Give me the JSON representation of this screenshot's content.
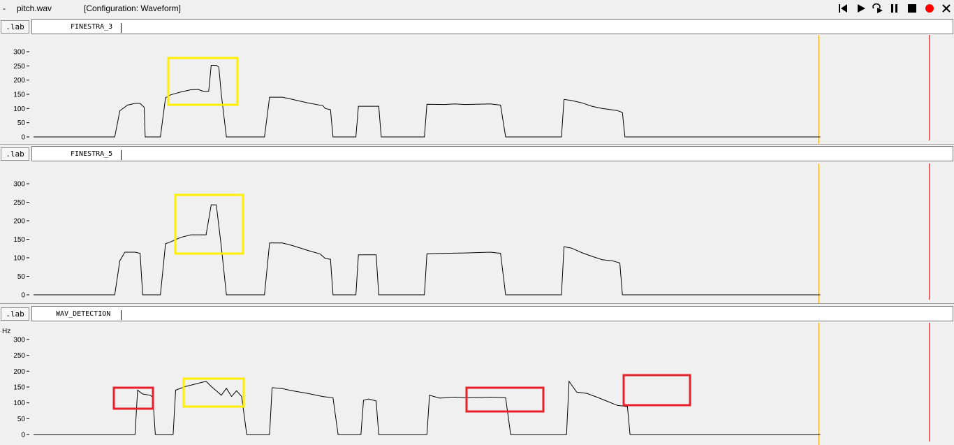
{
  "window": {
    "menu_glyph": "-",
    "filename": "pitch.wav",
    "configuration": "[Configuration: Waveform]"
  },
  "toolbar": {
    "icons": [
      "skip-to-start-icon",
      "play-icon",
      "loop-play-icon",
      "pause-icon",
      "stop-icon",
      "record-icon",
      "close-icon"
    ],
    "record_color": "#ff0000"
  },
  "colors": {
    "marker_orange": "#f0a020",
    "marker_red": "#e02020",
    "highlight_yellow": "#ffee00",
    "highlight_red": "#e8202a"
  },
  "tracks": [
    {
      "lab_button": ".lab",
      "label": "FINESTRA_3",
      "unit": "",
      "yticks": [
        300,
        250,
        200,
        150,
        100,
        50,
        0
      ],
      "points": [
        [
          0,
          0
        ],
        [
          0.16,
          0
        ],
        [
          0.17,
          92
        ],
        [
          0.185,
          112
        ],
        [
          0.2,
          118
        ],
        [
          0.21,
          118
        ],
        [
          0.218,
          104
        ],
        [
          0.22,
          0
        ],
        [
          0.25,
          0
        ],
        [
          0.26,
          138
        ],
        [
          0.27,
          148
        ],
        [
          0.29,
          158
        ],
        [
          0.31,
          166
        ],
        [
          0.325,
          167
        ],
        [
          0.335,
          160
        ],
        [
          0.345,
          160
        ],
        [
          0.35,
          252
        ],
        [
          0.36,
          252
        ],
        [
          0.365,
          246
        ],
        [
          0.37,
          150
        ],
        [
          0.38,
          0
        ],
        [
          0.455,
          0
        ],
        [
          0.465,
          140
        ],
        [
          0.49,
          140
        ],
        [
          0.51,
          132
        ],
        [
          0.54,
          120
        ],
        [
          0.57,
          110
        ],
        [
          0.575,
          100
        ],
        [
          0.585,
          96
        ],
        [
          0.59,
          0
        ],
        [
          0.635,
          0
        ],
        [
          0.64,
          108
        ],
        [
          0.68,
          108
        ],
        [
          0.685,
          0
        ],
        [
          0.77,
          0
        ],
        [
          0.775,
          115
        ],
        [
          0.81,
          114
        ],
        [
          0.83,
          116
        ],
        [
          0.85,
          114
        ],
        [
          0.9,
          116
        ],
        [
          0.92,
          112
        ],
        [
          0.93,
          0
        ],
        [
          1.04,
          0
        ],
        [
          1.045,
          132
        ],
        [
          1.06,
          128
        ],
        [
          1.08,
          120
        ],
        [
          1.1,
          108
        ],
        [
          1.12,
          100
        ],
        [
          1.15,
          93
        ],
        [
          1.16,
          86
        ],
        [
          1.165,
          0
        ],
        [
          1.55,
          0
        ]
      ]
    },
    {
      "lab_button": ".lab",
      "label": "FINESTRA_5",
      "unit": "",
      "yticks": [
        300,
        250,
        200,
        150,
        100,
        50,
        0
      ],
      "points": [
        [
          0,
          0
        ],
        [
          0.16,
          0
        ],
        [
          0.17,
          92
        ],
        [
          0.18,
          115
        ],
        [
          0.2,
          115
        ],
        [
          0.21,
          112
        ],
        [
          0.215,
          0
        ],
        [
          0.25,
          0
        ],
        [
          0.26,
          138
        ],
        [
          0.27,
          143
        ],
        [
          0.29,
          155
        ],
        [
          0.31,
          162
        ],
        [
          0.34,
          162
        ],
        [
          0.35,
          243
        ],
        [
          0.36,
          243
        ],
        [
          0.37,
          130
        ],
        [
          0.38,
          0
        ],
        [
          0.455,
          0
        ],
        [
          0.465,
          140
        ],
        [
          0.49,
          140
        ],
        [
          0.51,
          133
        ],
        [
          0.54,
          120
        ],
        [
          0.565,
          110
        ],
        [
          0.575,
          98
        ],
        [
          0.585,
          96
        ],
        [
          0.59,
          0
        ],
        [
          0.635,
          0
        ],
        [
          0.64,
          108
        ],
        [
          0.675,
          108
        ],
        [
          0.68,
          0
        ],
        [
          0.77,
          0
        ],
        [
          0.775,
          111
        ],
        [
          0.81,
          112
        ],
        [
          0.85,
          113
        ],
        [
          0.9,
          115
        ],
        [
          0.92,
          112
        ],
        [
          0.93,
          0
        ],
        [
          1.04,
          0
        ],
        [
          1.045,
          130
        ],
        [
          1.06,
          126
        ],
        [
          1.08,
          114
        ],
        [
          1.1,
          104
        ],
        [
          1.12,
          95
        ],
        [
          1.14,
          92
        ],
        [
          1.155,
          86
        ],
        [
          1.16,
          0
        ],
        [
          1.55,
          0
        ]
      ]
    },
    {
      "lab_button": ".lab",
      "label": "WAV_DETECTION",
      "unit": "Hz",
      "yticks": [
        300,
        250,
        200,
        150,
        100,
        50,
        0
      ],
      "points": [
        [
          0,
          0
        ],
        [
          0.16,
          0
        ],
        [
          0.2,
          0
        ],
        [
          0.205,
          140
        ],
        [
          0.215,
          128
        ],
        [
          0.23,
          124
        ],
        [
          0.235,
          118
        ],
        [
          0.24,
          0
        ],
        [
          0.275,
          0
        ],
        [
          0.28,
          140
        ],
        [
          0.3,
          152
        ],
        [
          0.32,
          160
        ],
        [
          0.34,
          168
        ],
        [
          0.35,
          152
        ],
        [
          0.36,
          138
        ],
        [
          0.37,
          124
        ],
        [
          0.38,
          146
        ],
        [
          0.39,
          120
        ],
        [
          0.4,
          138
        ],
        [
          0.41,
          120
        ],
        [
          0.42,
          0
        ],
        [
          0.465,
          0
        ],
        [
          0.47,
          148
        ],
        [
          0.49,
          145
        ],
        [
          0.51,
          138
        ],
        [
          0.54,
          130
        ],
        [
          0.57,
          120
        ],
        [
          0.59,
          116
        ],
        [
          0.6,
          0
        ],
        [
          0.645,
          0
        ],
        [
          0.65,
          108
        ],
        [
          0.66,
          112
        ],
        [
          0.675,
          106
        ],
        [
          0.68,
          0
        ],
        [
          0.775,
          0
        ],
        [
          0.78,
          124
        ],
        [
          0.8,
          115
        ],
        [
          0.83,
          118
        ],
        [
          0.85,
          116
        ],
        [
          0.88,
          117
        ],
        [
          0.9,
          118
        ],
        [
          0.93,
          116
        ],
        [
          0.94,
          0
        ],
        [
          1.05,
          0
        ],
        [
          1.055,
          168
        ],
        [
          1.07,
          134
        ],
        [
          1.09,
          130
        ],
        [
          1.11,
          118
        ],
        [
          1.13,
          105
        ],
        [
          1.15,
          92
        ],
        [
          1.17,
          88
        ],
        [
          1.175,
          0
        ],
        [
          1.55,
          0
        ]
      ]
    }
  ]
}
